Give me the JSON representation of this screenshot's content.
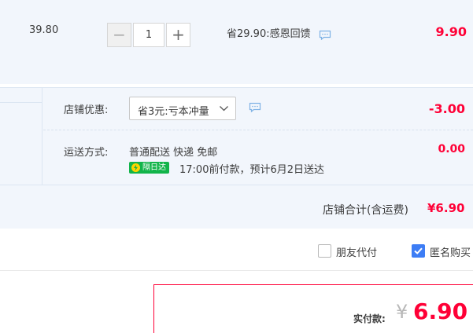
{
  "item": {
    "unit_price": "39.80",
    "quantity": "1",
    "minus_label": "−",
    "plus_label": "+",
    "promo_text": "省29.90:感恩回馈",
    "subtotal": "9.90"
  },
  "shop": {
    "coupon_label": "店铺优惠:",
    "coupon_selected": "省3元:亏本冲量",
    "discount": "-3.00",
    "shipping_label": "运送方式:",
    "shipping_method": "普通配送 快递 免邮",
    "shipping_fee": "0.00",
    "badge_text": "隔日达",
    "delivery_note": "17:00前付款，预计6月2日送达",
    "total_label": "店铺合计(含运费)",
    "total_value": "¥6.90"
  },
  "options": {
    "pay_by_friend_label": "朋友代付",
    "pay_by_friend_checked": false,
    "anonymous_label": "匿名购买",
    "anonymous_checked": true
  },
  "payment": {
    "label": "实付款:",
    "currency": "¥",
    "amount": "6.90"
  },
  "colors": {
    "price_red": "#ff0036",
    "panel_bg": "#f2f6fc",
    "badge_green": "#12b44a",
    "checkbox_blue": "#3d7df5"
  },
  "icons": [
    "minus-icon",
    "plus-icon",
    "chat-bubble-icon",
    "chevron-down-icon",
    "lightning-icon",
    "check-icon"
  ]
}
